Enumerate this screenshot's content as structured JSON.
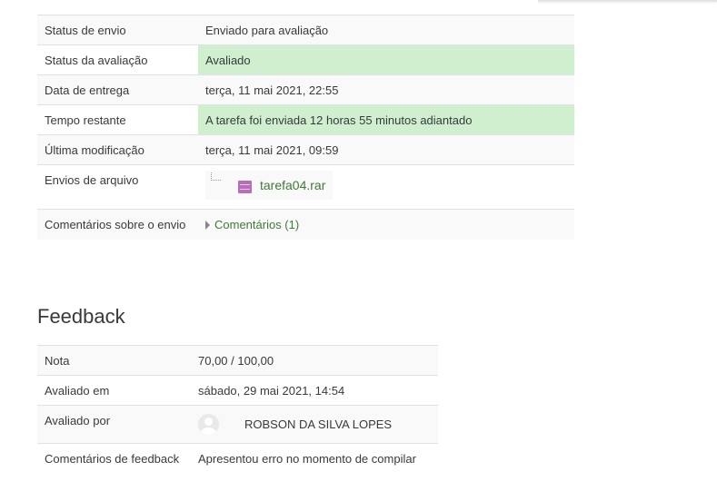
{
  "submission_status": {
    "rows": [
      {
        "label": "Status de envio",
        "value": "Enviado para avaliação"
      },
      {
        "label": "Status da avaliação",
        "value": "Avaliado"
      },
      {
        "label": "Data de entrega",
        "value": "terça, 11 mai 2021, 22:55"
      },
      {
        "label": "Tempo restante",
        "value": "A tarefa foi enviada 12 horas 55 minutos adiantado"
      },
      {
        "label": "Última modificação",
        "value": "terça, 11 mai 2021, 09:59"
      },
      {
        "label": "Envios de arquivo",
        "file_name": "tarefa04.rar",
        "file_icon": "archive-icon"
      },
      {
        "label": "Comentários sobre o envio",
        "comments_link": "Comentários (1)"
      }
    ],
    "highlight_color": "#cfefcf",
    "link_color": "#3f7a37"
  },
  "feedback": {
    "heading": "Feedback",
    "rows": [
      {
        "label": "Nota",
        "value": "70,00 / 100,00"
      },
      {
        "label": "Avaliado em",
        "value": "sábado, 29 mai 2021, 14:54"
      },
      {
        "label": "Avaliado por",
        "grader_name": "ROBSON DA SILVA LOPES",
        "avatar_icon": "user-avatar-icon"
      },
      {
        "label": "Comentários de feedback",
        "value": "Apresentou erro no momento de compilar"
      }
    ]
  }
}
